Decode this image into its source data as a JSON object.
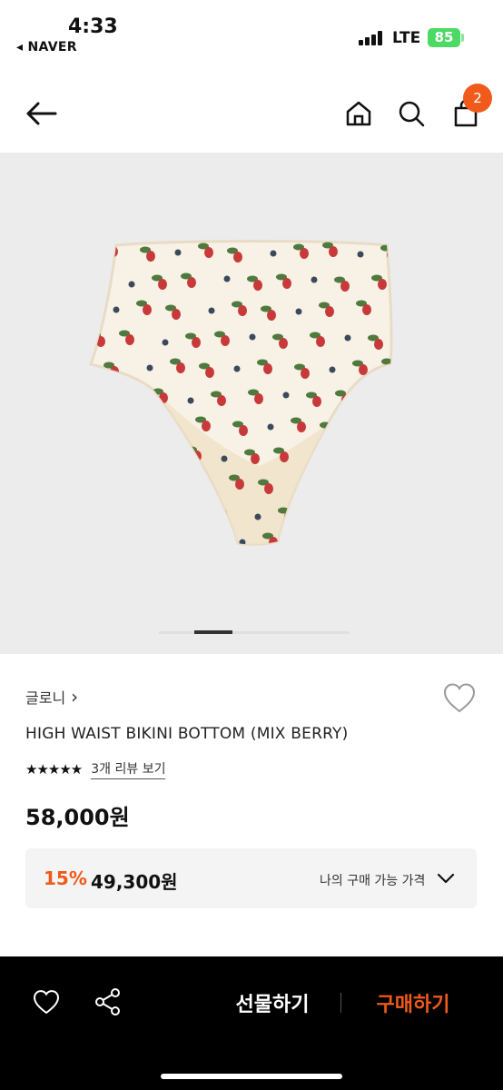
{
  "status": {
    "time": "4:33",
    "back_app": "◂ NAVER",
    "network": "LTE",
    "battery": "85"
  },
  "nav": {
    "cart_count": "2"
  },
  "product": {
    "brand": "글로니",
    "brand_chevron": "›",
    "title": "HIGH WAIST BIKINI BOTTOM (MIX BERRY)",
    "rating": 4.5,
    "stars": "★★★★★",
    "review_link": "3개 리뷰 보기",
    "price": "58,000원",
    "image_count": 4,
    "current_image": 2
  },
  "discount": {
    "percent": "15%",
    "price": "49,300원",
    "label": "나의 구매 가능 가격"
  },
  "bottom_bar": {
    "gift_label": "선물하기",
    "buy_label": "구매하기"
  },
  "colors": {
    "accent": "#f05a1a",
    "image_bg": "#ececec",
    "bottom_bar": "#000000"
  }
}
